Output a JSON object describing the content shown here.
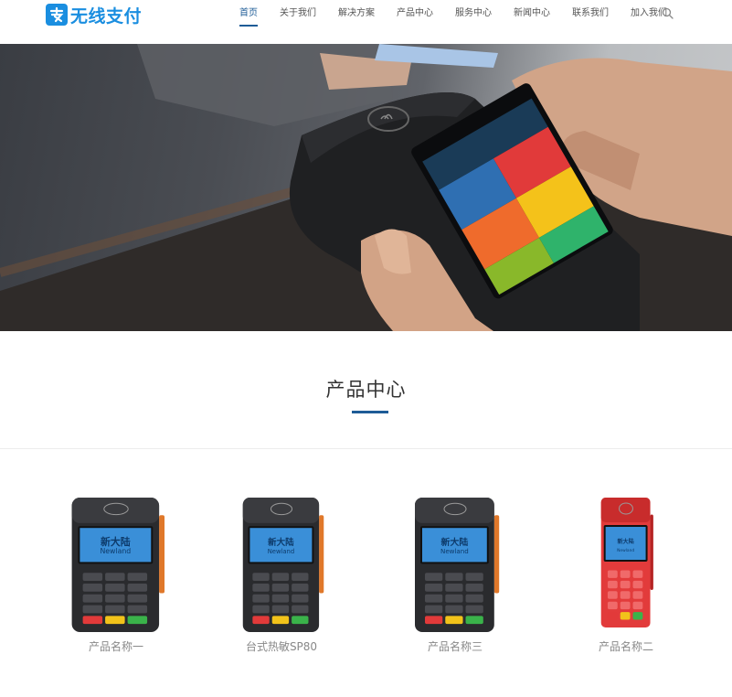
{
  "header": {
    "logo_text": "无线支付",
    "nav": [
      {
        "label": "首页",
        "active": true
      },
      {
        "label": "关于我们",
        "active": false
      },
      {
        "label": "解决方案",
        "active": false
      },
      {
        "label": "产品中心",
        "active": false
      },
      {
        "label": "服务中心",
        "active": false
      },
      {
        "label": "新闻中心",
        "active": false
      },
      {
        "label": "联系我们",
        "active": false
      },
      {
        "label": "加入我们",
        "active": false
      }
    ],
    "search_icon": "search-icon"
  },
  "banner": {
    "slides": 4,
    "active_slide": 3
  },
  "products_section": {
    "title": "产品中心",
    "items": [
      {
        "name": "产品名称一",
        "color": "dark"
      },
      {
        "name": "台式热敏SP80",
        "color": "dark"
      },
      {
        "name": "产品名称三",
        "color": "dark"
      },
      {
        "name": "产品名称二",
        "color": "red"
      }
    ],
    "terminal_screen_text": "新大陆",
    "terminal_screen_subtext": "Newland"
  },
  "colors": {
    "brand": "#1a8ee0",
    "accent": "#1e5c97",
    "terminal_red": "#e23b3b"
  }
}
